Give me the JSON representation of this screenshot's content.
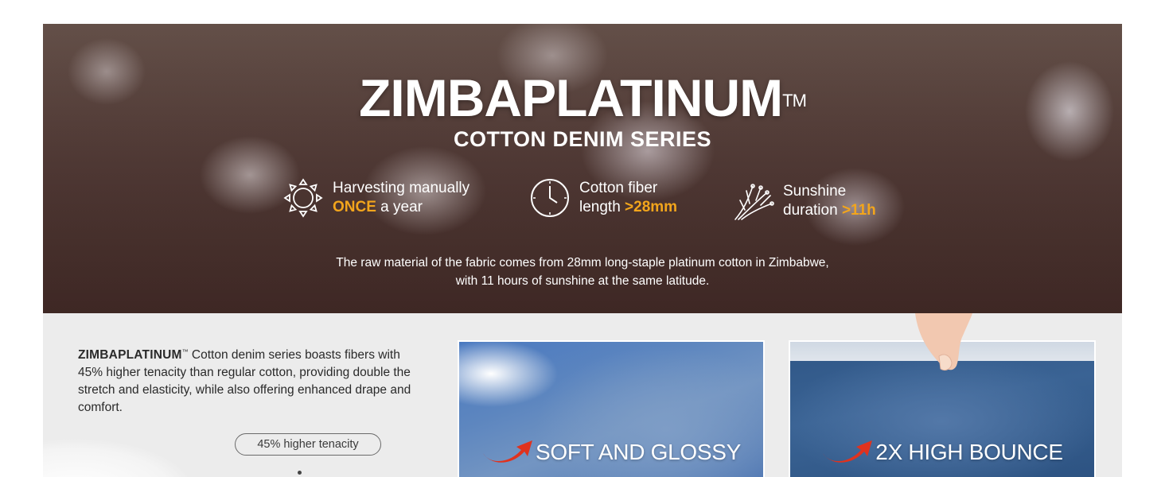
{
  "hero": {
    "brand": "ZIMBAPLATINUM",
    "trademark": "TM",
    "subtitle": "COTTON DENIM SERIES",
    "features": [
      {
        "icon": "sun-icon",
        "line1": "Harvesting manually",
        "highlight": "ONCE",
        "line2_rest": " a year"
      },
      {
        "icon": "clock-icon",
        "line1": "Cotton fiber",
        "line2_pre": "length ",
        "highlight": ">28mm"
      },
      {
        "icon": "fiber-icon",
        "line1": "Sunshine",
        "line2_pre": "duration ",
        "highlight": ">11h"
      }
    ],
    "note_line1": "The raw material of the fabric comes from 28mm long-staple platinum cotton in Zimbabwe,",
    "note_line2": "with 11 hours of sunshine at the same latitude.",
    "highlight_color": "#f2a51c"
  },
  "details": {
    "brand": "ZIMBAPLATINUM",
    "trademark": "™",
    "text": " Cotton denim series boasts fibers with 45% higher tenacity than regular cotton, providing double the stretch and elasticity, while also offering enhanced drape and comfort.",
    "tenacity_label": "45% higher tenacity"
  },
  "cards": [
    {
      "label": "SOFT AND GLOSSY",
      "icon": "red-arrow-icon"
    },
    {
      "label": "2X HIGH BOUNCE",
      "icon": "red-arrow-icon"
    }
  ]
}
